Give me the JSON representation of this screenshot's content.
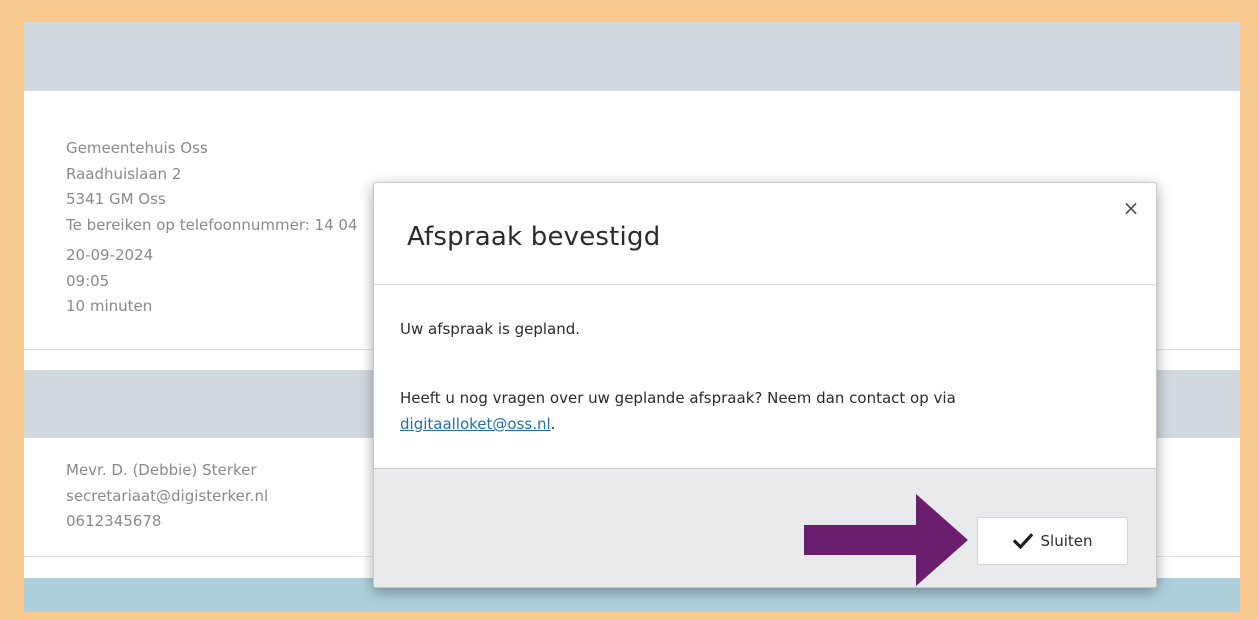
{
  "colors": {
    "frame": "#f7c98f",
    "band_grey": "#d2d9de",
    "band_blue": "#aed0dd",
    "arrow": "#6a1f6d",
    "link": "#1f6fb2"
  },
  "location": {
    "name": "Gemeentehuis Oss",
    "street": "Raadhuislaan 2",
    "postal_city": "5341 GM Oss",
    "phone_line": "Te bereiken op telefoonnummer: 14 04"
  },
  "appointment": {
    "date": "20-09-2024",
    "time": "09:05",
    "duration": "10 minuten"
  },
  "contact": {
    "name": "Mevr. D. (Debbie) Sterker",
    "email": "secretariaat@digisterker.nl",
    "phone": "0612345678"
  },
  "modal": {
    "title": "Afspraak bevestigd",
    "close_symbol": "×",
    "message": "Uw afspraak is gepland.",
    "question_text": "Heeft u nog vragen over uw geplande afspraak? Neem dan contact op via",
    "email_link": "digitaalloket@oss.nl",
    "period": ".",
    "button_label": "Sluiten",
    "button_icon": "checkmark-icon"
  }
}
